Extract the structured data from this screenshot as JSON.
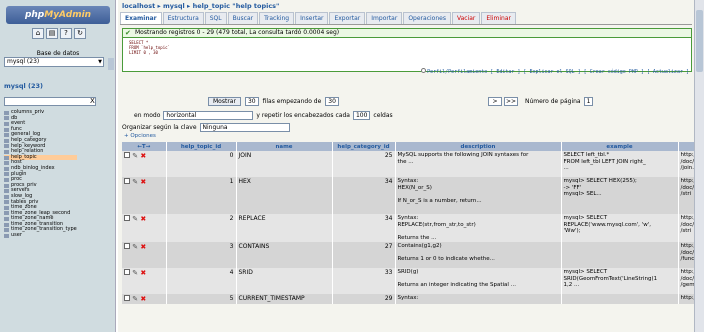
{
  "sidebar": {
    "logo_a": "php",
    "logo_b": "MyAdmin",
    "db_label": "Base de datos",
    "db_selected": "mysql (23)",
    "db_title": "mysql (23)",
    "tables": [
      "columns_priv",
      "db",
      "event",
      "func",
      "general_log",
      "help_category",
      "help_keyword",
      "help_relation",
      "help_topic",
      "host",
      "ndb_binlog_index",
      "plugin",
      "proc",
      "procs_priv",
      "servers",
      "slow_log",
      "tables_priv",
      "time_zone",
      "time_zone_leap_second",
      "time_zone_name",
      "time_zone_transition",
      "time_zone_transition_type",
      "user"
    ],
    "selected_table": "help_topic"
  },
  "breadcrumb": "localhost ▸ mysql ▸ help_topic \"help topics\"",
  "tabs": [
    "Examinar",
    "Estructura",
    "SQL",
    "Buscar",
    "Tracking",
    "Insertar",
    "Exportar",
    "Importar",
    "Operaciones",
    "Vaciar",
    "Eliminar"
  ],
  "success_msg": "Mostrando registros 0 - 29 (479 total, La consulta tardó 0.0004 seg)",
  "sql_lines": [
    "SELECT *",
    "FROM `help_topic`",
    "LIMIT 0 , 30"
  ],
  "sql_links": "Perfil/Perfilamiento [ Editar ] [ Explicar el SQL ] [ Crear código PHP ] [ Actualizar ]",
  "controls": {
    "show_btn": "Mostrar",
    "rows_value": "30",
    "rows_label": "filas empezando de",
    "start_value": "30",
    "next_btn": ">",
    "last_btn": ">>",
    "page_label": "Número de página",
    "page_value": "1",
    "mode_prefix": "en modo",
    "mode_value": "horizontal",
    "repeat_label": "y repetir los encabezados cada",
    "repeat_value": "100",
    "repeat_suffix": "celdas",
    "order_label": "Organizar según la clave",
    "order_value": "Ninguna",
    "options_link": "+ Opciones"
  },
  "table": {
    "headers": [
      "←T→",
      "help_topic_id",
      "name",
      "help_category_id",
      "description",
      "example",
      ""
    ],
    "rows": [
      {
        "id": "0",
        "name": "JOIN",
        "cat": "25",
        "desc": [
          "MySQL supports the following JOIN syntaxes for",
          "the ..."
        ],
        "example": [
          "SELECT left_tbl.*",
          "  FROM left_tbl LEFT JOIN right_",
          "..."
        ],
        "url": [
          "http:/",
          "/doc/",
          "/join."
        ]
      },
      {
        "id": "1",
        "name": "HEX",
        "cat": "34",
        "desc": [
          "Syntax:",
          "HEX(N_or_S)",
          "",
          "If N_or_S is a number, return..."
        ],
        "example": [
          "mysql> SELECT HEX(255);",
          "        -> 'FF'",
          "mysql> SEL..."
        ],
        "url": [
          "http:/",
          "/doc/",
          "/stri"
        ]
      },
      {
        "id": "2",
        "name": "REPLACE",
        "cat": "34",
        "desc": [
          "Syntax:",
          "REPLACE(str,from_str,to_str)",
          "",
          "Returns the ..."
        ],
        "example": [
          "mysql> SELECT",
          "REPLACE('www.mysql.com', 'w',",
          "'Ww');"
        ],
        "url": [
          "http:/",
          "/doc/",
          "/stri"
        ]
      },
      {
        "id": "3",
        "name": "CONTAINS",
        "cat": "27",
        "desc": [
          "Contains(g1,g2)",
          "",
          "Returns 1 or 0 to indicate whethe..."
        ],
        "example": [
          ""
        ],
        "url": [
          "http:/",
          "/doc/",
          "/func"
        ]
      },
      {
        "id": "4",
        "name": "SRID",
        "cat": "33",
        "desc": [
          "SRID(g)",
          "",
          "Returns an integer indicating the Spatial ..."
        ],
        "example": [
          "mysql> SELECT",
          "SRID(GeomFromText('LineString(1",
          "1,2 ..."
        ],
        "url": [
          "http:/",
          "/doc/",
          "/gem"
        ]
      },
      {
        "id": "5",
        "name": "CURRENT_TIMESTAMP",
        "cat": "29",
        "desc": [
          "Syntax:"
        ],
        "example": [
          ""
        ],
        "url": [
          "http:/"
        ]
      }
    ]
  }
}
